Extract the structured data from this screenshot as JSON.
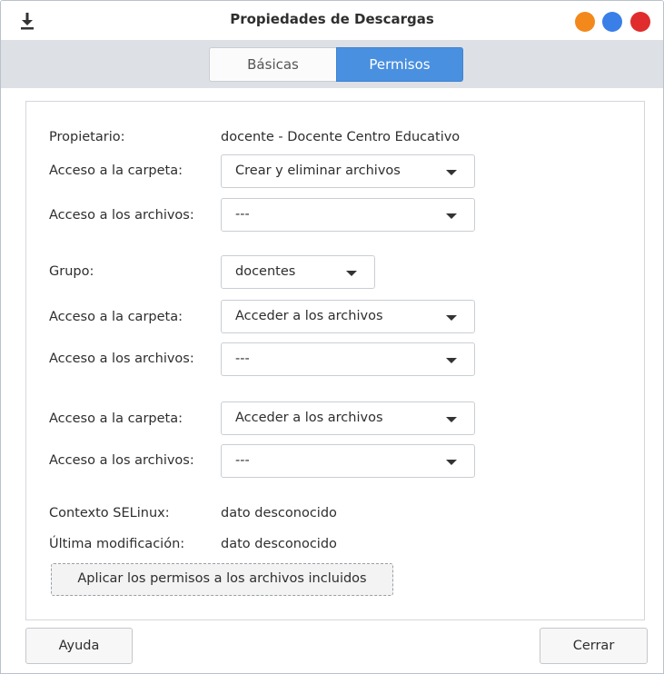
{
  "window": {
    "title": "Propiedades de Descargas",
    "icon": "download-arrow-icon",
    "controls": {
      "minimize_color": "#f3891b",
      "maximize_color": "#3a7ee8",
      "close_color": "#e02c2c"
    }
  },
  "tabs": [
    {
      "label": "Básicas",
      "selected": false
    },
    {
      "label": "Permisos",
      "selected": true
    }
  ],
  "owner": {
    "label": "Propietario:",
    "value": "docente - Docente Centro Educativo",
    "folder_access_label": "Acceso a la carpeta:",
    "folder_access_value": "Crear y eliminar archivos",
    "file_access_label": "Acceso a los archivos:",
    "file_access_value": "---"
  },
  "group": {
    "label": "Grupo:",
    "value": "docentes",
    "folder_access_label": "Acceso a la carpeta:",
    "folder_access_value": "Acceder a los archivos",
    "file_access_label": "Acceso a los archivos:",
    "file_access_value": "---"
  },
  "others": {
    "folder_access_label": "Acceso a la carpeta:",
    "folder_access_value": "Acceder a los archivos",
    "file_access_label": "Acceso a los archivos:",
    "file_access_value": "---"
  },
  "info": {
    "selinux_label": "Contexto SELinux:",
    "selinux_value": "dato desconocido",
    "modified_label": "Última modificación:",
    "modified_value": "dato desconocido"
  },
  "buttons": {
    "apply": "Aplicar los permisos a los archivos incluidos",
    "help": "Ayuda",
    "close": "Cerrar"
  },
  "colors": {
    "accent": "#4a90e0",
    "tabstrip_bg": "#dde0e4"
  }
}
